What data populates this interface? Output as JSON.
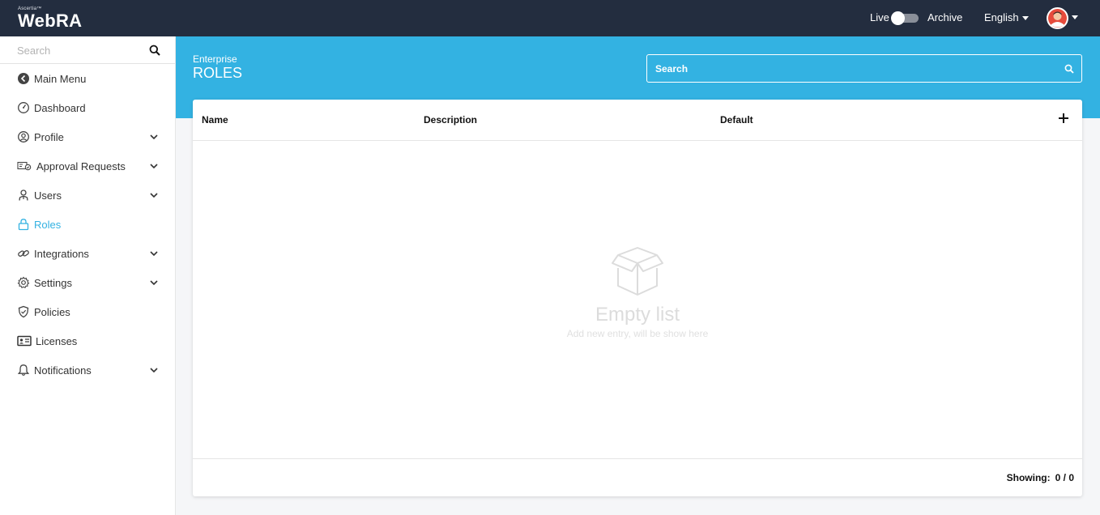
{
  "app": {
    "brand_small": "Ascertia™",
    "product": "WebRA"
  },
  "topbar": {
    "live_label": "Live",
    "archive_label": "Archive",
    "language": "English"
  },
  "sidebar": {
    "search_placeholder": "Search",
    "items": [
      {
        "label": "Main Menu",
        "icon": "back-arrow-icon"
      },
      {
        "label": "Dashboard",
        "icon": "dashboard-icon"
      },
      {
        "label": "Profile",
        "icon": "profile-icon"
      },
      {
        "label": "Approval Requests",
        "icon": "approval-requests-icon"
      },
      {
        "label": "Users",
        "icon": "users-icon"
      },
      {
        "label": "Roles",
        "icon": "lock-icon"
      },
      {
        "label": "Integrations",
        "icon": "link-icon"
      },
      {
        "label": "Settings",
        "icon": "gear-icon"
      },
      {
        "label": "Policies",
        "icon": "shield-icon"
      },
      {
        "label": "Licenses",
        "icon": "id-card-icon"
      },
      {
        "label": "Notifications",
        "icon": "bell-icon"
      }
    ]
  },
  "page": {
    "breadcrumb": "Enterprise",
    "title": "ROLES",
    "search_placeholder": "Search"
  },
  "table": {
    "columns": [
      "Name",
      "Description",
      "Default"
    ],
    "empty_title": "Empty list",
    "empty_subtitle": "Add new entry, will be show here",
    "showing_label": "Showing:",
    "showing_value": "0 / 0"
  },
  "colors": {
    "topbar": "#232d3f",
    "accent": "#33b2e2"
  }
}
